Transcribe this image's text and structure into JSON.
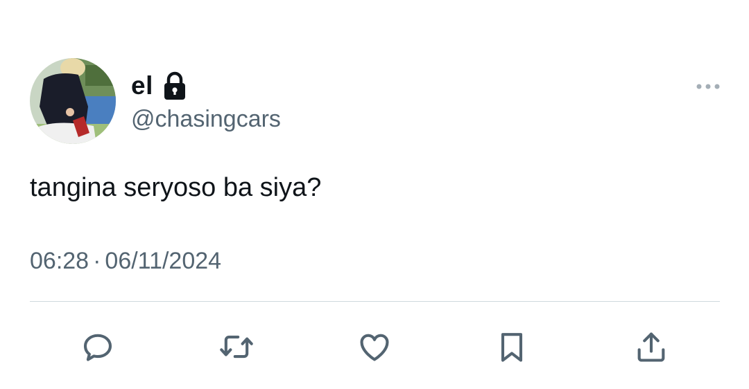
{
  "tweet": {
    "author": {
      "display_name": "el",
      "handle": "@chasingcars",
      "protected_icon": "lock-icon",
      "avatar": "profile-photo"
    },
    "text": "tangina seryoso ba siya?",
    "time": "06:28",
    "separator": "·",
    "date": "06/11/2024",
    "more_icon": "more-horizontal-icon"
  },
  "actions": [
    {
      "name": "reply",
      "icon": "reply-icon"
    },
    {
      "name": "retweet",
      "icon": "retweet-icon"
    },
    {
      "name": "like",
      "icon": "heart-icon"
    },
    {
      "name": "bookmark",
      "icon": "bookmark-icon"
    },
    {
      "name": "share",
      "icon": "share-icon"
    }
  ],
  "colors": {
    "text_primary": "#0f1419",
    "text_secondary": "#536471",
    "divider": "#cfd9de"
  }
}
